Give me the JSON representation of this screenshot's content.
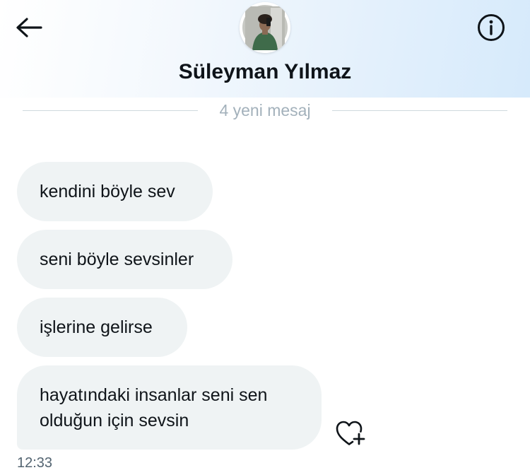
{
  "header": {
    "contact_name": "Süleyman Yılmaz",
    "back_icon": "arrow-left-icon",
    "info_icon": "info-circle-icon"
  },
  "divider": {
    "text": "4 yeni mesaj"
  },
  "messages": [
    {
      "text": "kendini böyle sev"
    },
    {
      "text": "seni böyle sevsinler"
    },
    {
      "text": "işlerine gelirse"
    },
    {
      "text": "hayatındaki insanlar seni sen olduğun için sevsin"
    }
  ],
  "last_message_time": "12:33",
  "like_icon": "heart-plus-icon",
  "colors": {
    "bubble_bg": "#eff3f4",
    "text": "#0f1419",
    "muted": "#536471",
    "divider_text": "#a3b1bb",
    "divider_line": "#cfd9de"
  }
}
